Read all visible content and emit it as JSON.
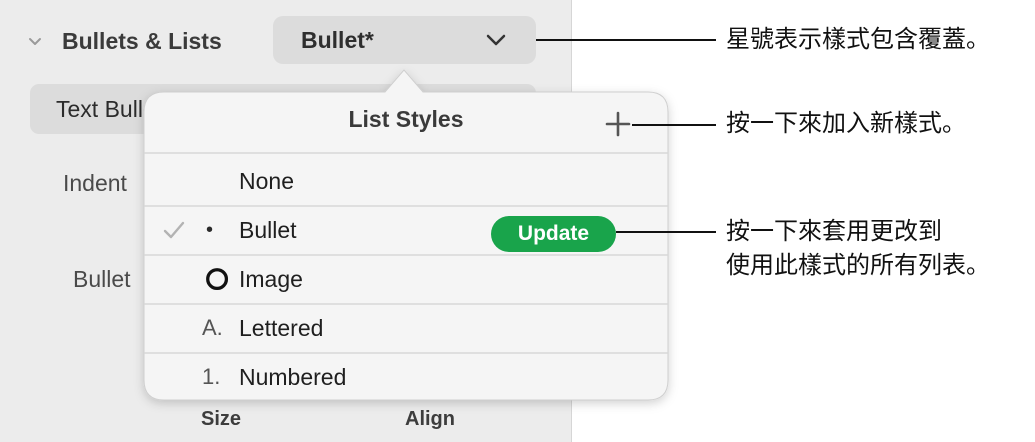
{
  "sidebar": {
    "section_title": "Bullets & Lists",
    "style_dropdown": {
      "value": "Bullet*"
    },
    "bullet_type_select": {
      "value": "Text Bullets"
    },
    "indent_label": "Indent",
    "bullet_label": "Bullet",
    "size_label": "Size",
    "align_label": "Align"
  },
  "popover": {
    "title": "List Styles",
    "update_label": "Update",
    "rows": [
      {
        "label": "None",
        "marker": "",
        "checked": false
      },
      {
        "label": "Bullet",
        "marker": "•",
        "checked": true
      },
      {
        "label": "Image",
        "marker": "image-ring",
        "checked": false
      },
      {
        "label": "Lettered",
        "marker": "A.",
        "checked": false
      },
      {
        "label": "Numbered",
        "marker": "1.",
        "checked": false
      }
    ]
  },
  "callouts": {
    "asterisk": "星號表示樣式包含覆蓋。",
    "add_style": "按一下來加入新樣式。",
    "update_line1": "按一下來套用更改到",
    "update_line2": "使用此樣式的所有列表。"
  },
  "colors": {
    "update_green": "#19a44b",
    "sidebar_bg": "#ececec",
    "popover_bg": "#f5f5f5"
  }
}
